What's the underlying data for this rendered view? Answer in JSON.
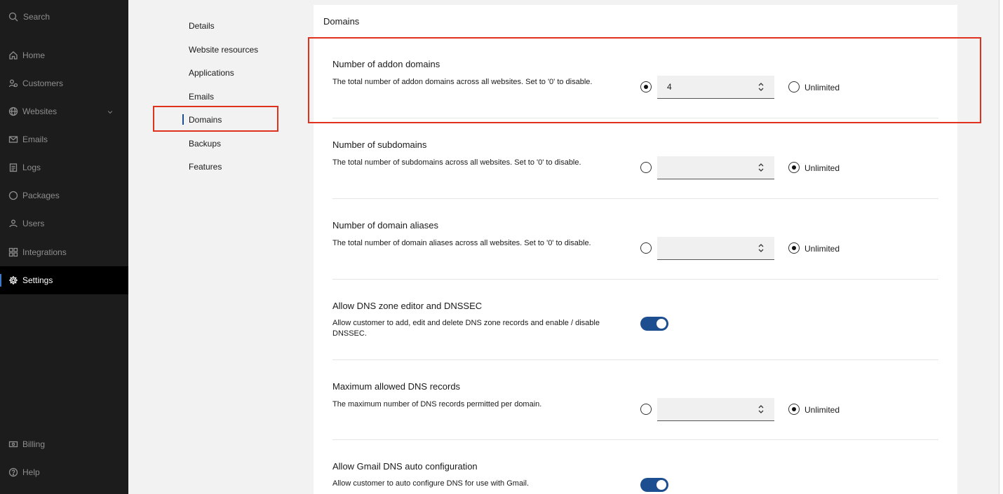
{
  "sidebar": {
    "search_label": "Search",
    "items": [
      {
        "label": "Home",
        "icon": "home-icon"
      },
      {
        "label": "Customers",
        "icon": "customers-icon"
      },
      {
        "label": "Websites",
        "icon": "globe-icon"
      },
      {
        "label": "Emails",
        "icon": "mail-icon"
      },
      {
        "label": "Logs",
        "icon": "logs-icon"
      },
      {
        "label": "Packages",
        "icon": "package-icon"
      },
      {
        "label": "Users",
        "icon": "users-icon"
      },
      {
        "label": "Integrations",
        "icon": "integrations-icon"
      },
      {
        "label": "Settings",
        "icon": "gear-icon",
        "active": true
      }
    ],
    "bottom": [
      {
        "label": "Billing",
        "icon": "billing-icon"
      },
      {
        "label": "Help",
        "icon": "help-icon"
      }
    ]
  },
  "subnav": {
    "items": [
      "Details",
      "Website resources",
      "Applications",
      "Emails",
      "Domains",
      "Backups",
      "Features"
    ],
    "active": "Domains"
  },
  "panel": {
    "title": "Domains",
    "sections": [
      {
        "title": "Number of addon domains",
        "desc": "The total number of addon domains across all websites. Set to '0' to disable.",
        "value": "4",
        "selected": "value",
        "unlimited_label": "Unlimited"
      },
      {
        "title": "Number of subdomains",
        "desc": "The total number of subdomains across all websites. Set to '0' to disable.",
        "value": "",
        "selected": "unlimited",
        "unlimited_label": "Unlimited"
      },
      {
        "title": "Number of domain aliases",
        "desc": "The total number of domain aliases across all websites. Set to '0' to disable.",
        "value": "",
        "selected": "unlimited",
        "unlimited_label": "Unlimited"
      },
      {
        "title": "Allow DNS zone editor and DNSSEC",
        "desc": "Allow customer to add, edit and delete DNS zone records and enable / disable DNSSEC.",
        "toggle": true
      },
      {
        "title": "Maximum allowed DNS records",
        "desc": "The maximum number of DNS records permitted per domain.",
        "value": "",
        "selected": "unlimited",
        "unlimited_label": "Unlimited"
      },
      {
        "title": "Allow Gmail DNS auto configuration",
        "desc": "Allow customer to auto configure DNS for use with Gmail.",
        "toggle": true
      }
    ]
  },
  "colors": {
    "sidebar_bg": "#1c1c1c",
    "accent": "#1d4e8f",
    "highlight": "#e0301e"
  }
}
